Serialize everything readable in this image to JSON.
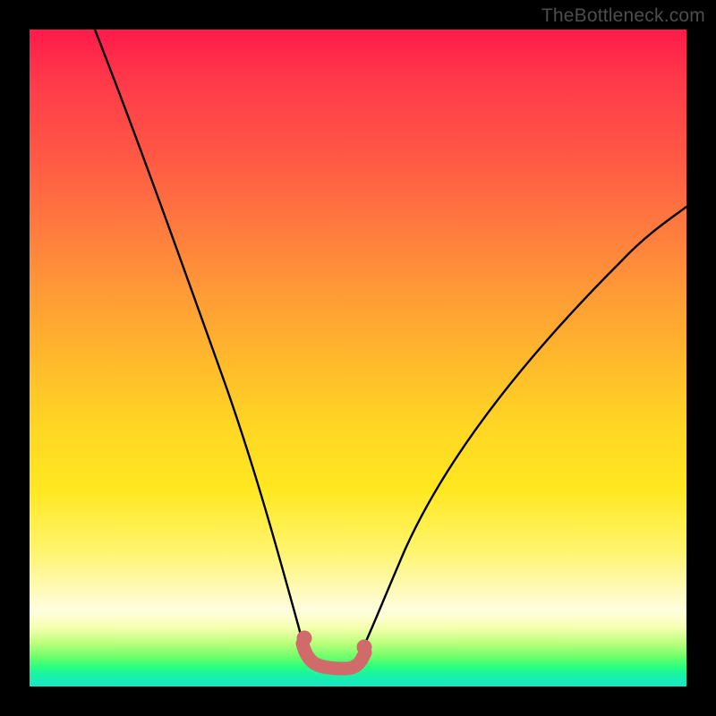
{
  "watermark": "TheBottleneck.com",
  "colors": {
    "frame": "#000000",
    "curve": "#000000",
    "marker": "#d16a6a",
    "gradient_top": "#ff1a4a",
    "gradient_mid": "#ffd524",
    "gradient_bottom": "#19e6c8"
  },
  "chart_data": {
    "type": "line",
    "title": "",
    "xlabel": "",
    "ylabel": "",
    "xlim": [
      0,
      100
    ],
    "ylim": [
      0,
      100
    ],
    "grid": false,
    "series": [
      {
        "name": "left-branch",
        "x": [
          10,
          14,
          18,
          22,
          26,
          30,
          34,
          37,
          39,
          40.5,
          41.5
        ],
        "values": [
          100,
          85,
          72,
          60,
          49,
          39,
          29,
          20,
          13,
          8,
          5.2
        ]
      },
      {
        "name": "right-branch",
        "x": [
          50.7,
          52.3,
          55,
          60,
          66,
          73,
          81,
          90,
          100
        ],
        "values": [
          5.2,
          7.5,
          11,
          19,
          29,
          40,
          51,
          62,
          73
        ]
      },
      {
        "name": "bottom-marker",
        "x": [
          41.5,
          42.5,
          43.5,
          45,
          47,
          49,
          50,
          50.7
        ],
        "values": [
          5.2,
          3.8,
          3.1,
          2.8,
          2.8,
          3.0,
          3.6,
          5.2
        ]
      }
    ],
    "annotations": []
  }
}
